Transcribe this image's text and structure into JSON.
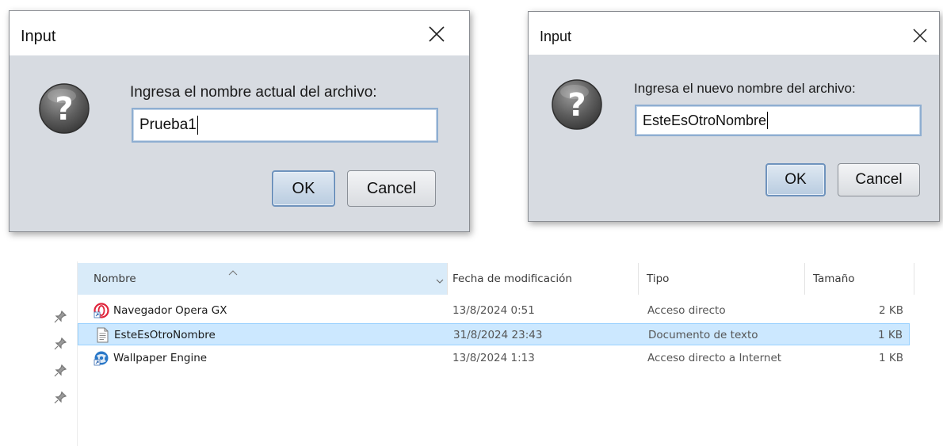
{
  "dialogs": [
    {
      "title": "Input",
      "prompt": "Ingresa el nombre actual del archivo:",
      "field_value": "Prueba1",
      "ok_label": "OK",
      "cancel_label": "Cancel",
      "icon": "question-icon",
      "close_icon": "close-icon"
    },
    {
      "title": "Input",
      "prompt": "Ingresa el nuevo nombre del archivo:",
      "field_value": "EsteEsOtroNombre",
      "ok_label": "OK",
      "cancel_label": "Cancel",
      "icon": "question-icon",
      "close_icon": "close-icon"
    }
  ],
  "explorer": {
    "columns": {
      "name": "Nombre",
      "date": "Fecha de modificación",
      "type": "Tipo",
      "size": "Tamaño"
    },
    "sorted_column": "name",
    "rows": [
      {
        "name": "Navegador Opera GX",
        "date": "13/8/2024 0:51",
        "type": "Acceso directo",
        "size": "2 KB",
        "icon": "opera-gx-icon",
        "selected": false
      },
      {
        "name": "EsteEsOtroNombre",
        "date": "31/8/2024 23:43",
        "type": "Documento de texto",
        "size": "1 KB",
        "icon": "text-document-icon",
        "selected": true
      },
      {
        "name": "Wallpaper Engine",
        "date": "13/8/2024 1:13",
        "type": "Acceso directo a Internet",
        "size": "1 KB",
        "icon": "wallpaper-engine-icon",
        "selected": false
      }
    ],
    "pin_icons": [
      "pin-icon",
      "pin-icon",
      "pin-icon",
      "pin-icon"
    ]
  },
  "colors": {
    "dialog_bg": "#d7dbe1",
    "field_border": "#8eaed1",
    "selection_bg": "#cce8ff",
    "header_sorted_bg": "#d9ebf9"
  }
}
